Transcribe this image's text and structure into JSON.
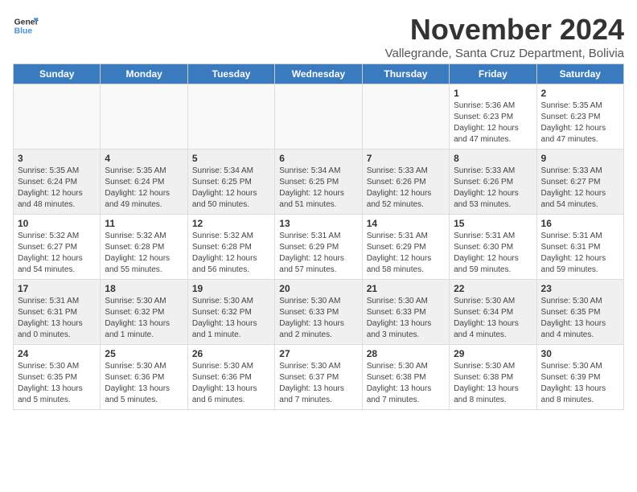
{
  "logo": {
    "line1": "General",
    "line2": "Blue"
  },
  "title": "November 2024",
  "subtitle": "Vallegrande, Santa Cruz Department, Bolivia",
  "weekdays": [
    "Sunday",
    "Monday",
    "Tuesday",
    "Wednesday",
    "Thursday",
    "Friday",
    "Saturday"
  ],
  "weeks": [
    [
      {
        "day": "",
        "info": ""
      },
      {
        "day": "",
        "info": ""
      },
      {
        "day": "",
        "info": ""
      },
      {
        "day": "",
        "info": ""
      },
      {
        "day": "",
        "info": ""
      },
      {
        "day": "1",
        "info": "Sunrise: 5:36 AM\nSunset: 6:23 PM\nDaylight: 12 hours\nand 47 minutes."
      },
      {
        "day": "2",
        "info": "Sunrise: 5:35 AM\nSunset: 6:23 PM\nDaylight: 12 hours\nand 47 minutes."
      }
    ],
    [
      {
        "day": "3",
        "info": "Sunrise: 5:35 AM\nSunset: 6:24 PM\nDaylight: 12 hours\nand 48 minutes."
      },
      {
        "day": "4",
        "info": "Sunrise: 5:35 AM\nSunset: 6:24 PM\nDaylight: 12 hours\nand 49 minutes."
      },
      {
        "day": "5",
        "info": "Sunrise: 5:34 AM\nSunset: 6:25 PM\nDaylight: 12 hours\nand 50 minutes."
      },
      {
        "day": "6",
        "info": "Sunrise: 5:34 AM\nSunset: 6:25 PM\nDaylight: 12 hours\nand 51 minutes."
      },
      {
        "day": "7",
        "info": "Sunrise: 5:33 AM\nSunset: 6:26 PM\nDaylight: 12 hours\nand 52 minutes."
      },
      {
        "day": "8",
        "info": "Sunrise: 5:33 AM\nSunset: 6:26 PM\nDaylight: 12 hours\nand 53 minutes."
      },
      {
        "day": "9",
        "info": "Sunrise: 5:33 AM\nSunset: 6:27 PM\nDaylight: 12 hours\nand 54 minutes."
      }
    ],
    [
      {
        "day": "10",
        "info": "Sunrise: 5:32 AM\nSunset: 6:27 PM\nDaylight: 12 hours\nand 54 minutes."
      },
      {
        "day": "11",
        "info": "Sunrise: 5:32 AM\nSunset: 6:28 PM\nDaylight: 12 hours\nand 55 minutes."
      },
      {
        "day": "12",
        "info": "Sunrise: 5:32 AM\nSunset: 6:28 PM\nDaylight: 12 hours\nand 56 minutes."
      },
      {
        "day": "13",
        "info": "Sunrise: 5:31 AM\nSunset: 6:29 PM\nDaylight: 12 hours\nand 57 minutes."
      },
      {
        "day": "14",
        "info": "Sunrise: 5:31 AM\nSunset: 6:29 PM\nDaylight: 12 hours\nand 58 minutes."
      },
      {
        "day": "15",
        "info": "Sunrise: 5:31 AM\nSunset: 6:30 PM\nDaylight: 12 hours\nand 59 minutes."
      },
      {
        "day": "16",
        "info": "Sunrise: 5:31 AM\nSunset: 6:31 PM\nDaylight: 12 hours\nand 59 minutes."
      }
    ],
    [
      {
        "day": "17",
        "info": "Sunrise: 5:31 AM\nSunset: 6:31 PM\nDaylight: 13 hours\nand 0 minutes."
      },
      {
        "day": "18",
        "info": "Sunrise: 5:30 AM\nSunset: 6:32 PM\nDaylight: 13 hours\nand 1 minute."
      },
      {
        "day": "19",
        "info": "Sunrise: 5:30 AM\nSunset: 6:32 PM\nDaylight: 13 hours\nand 1 minute."
      },
      {
        "day": "20",
        "info": "Sunrise: 5:30 AM\nSunset: 6:33 PM\nDaylight: 13 hours\nand 2 minutes."
      },
      {
        "day": "21",
        "info": "Sunrise: 5:30 AM\nSunset: 6:33 PM\nDaylight: 13 hours\nand 3 minutes."
      },
      {
        "day": "22",
        "info": "Sunrise: 5:30 AM\nSunset: 6:34 PM\nDaylight: 13 hours\nand 4 minutes."
      },
      {
        "day": "23",
        "info": "Sunrise: 5:30 AM\nSunset: 6:35 PM\nDaylight: 13 hours\nand 4 minutes."
      }
    ],
    [
      {
        "day": "24",
        "info": "Sunrise: 5:30 AM\nSunset: 6:35 PM\nDaylight: 13 hours\nand 5 minutes."
      },
      {
        "day": "25",
        "info": "Sunrise: 5:30 AM\nSunset: 6:36 PM\nDaylight: 13 hours\nand 5 minutes."
      },
      {
        "day": "26",
        "info": "Sunrise: 5:30 AM\nSunset: 6:36 PM\nDaylight: 13 hours\nand 6 minutes."
      },
      {
        "day": "27",
        "info": "Sunrise: 5:30 AM\nSunset: 6:37 PM\nDaylight: 13 hours\nand 7 minutes."
      },
      {
        "day": "28",
        "info": "Sunrise: 5:30 AM\nSunset: 6:38 PM\nDaylight: 13 hours\nand 7 minutes."
      },
      {
        "day": "29",
        "info": "Sunrise: 5:30 AM\nSunset: 6:38 PM\nDaylight: 13 hours\nand 8 minutes."
      },
      {
        "day": "30",
        "info": "Sunrise: 5:30 AM\nSunset: 6:39 PM\nDaylight: 13 hours\nand 8 minutes."
      }
    ]
  ]
}
